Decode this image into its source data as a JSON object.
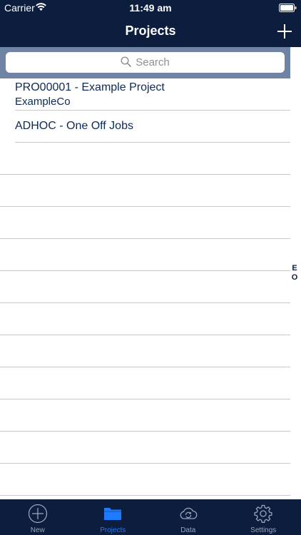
{
  "status_bar": {
    "carrier": "Carrier",
    "time": "11:49 am"
  },
  "nav": {
    "title": "Projects",
    "add_icon": "plus-icon"
  },
  "search": {
    "placeholder": "Search",
    "icon": "search-icon"
  },
  "projects": [
    {
      "title": "PRO00001 - Example Project",
      "subtitle": "ExampleCo"
    },
    {
      "title": "ADHOC - One Off Jobs",
      "subtitle": ""
    }
  ],
  "section_index": [
    "E",
    "O"
  ],
  "tabs": [
    {
      "label": "New",
      "icon": "plus-circle-icon",
      "active": false
    },
    {
      "label": "Projects",
      "icon": "folder-icon",
      "active": true
    },
    {
      "label": "Data",
      "icon": "cloud-sync-icon",
      "active": false
    },
    {
      "label": "Settings",
      "icon": "gear-icon",
      "active": false
    }
  ],
  "colors": {
    "bar_background": "#0c1d3e",
    "search_background": "#6f83a5",
    "text": "#0c2a56",
    "active_tab": "#1e7bff",
    "inactive_tab": "#9aa4b8"
  }
}
